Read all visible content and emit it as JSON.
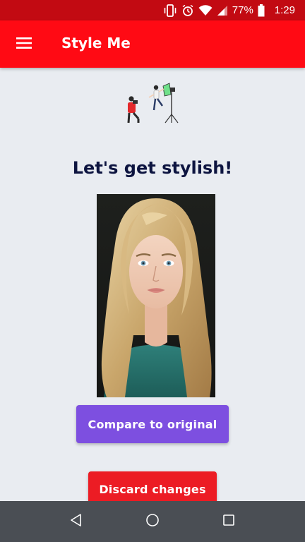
{
  "status_bar": {
    "battery_percent": "77%",
    "time": "1:29",
    "icons": [
      "vibrate-icon",
      "alarm-icon",
      "wifi-icon",
      "signal-icon",
      "battery-icon"
    ]
  },
  "app_bar": {
    "title": "Style Me",
    "menu_icon": "hamburger-menu-icon",
    "color": "#ff0a14"
  },
  "main": {
    "illustration": "photoshoot-illustration",
    "headline": "Let's get stylish!",
    "photo": "portrait-photo",
    "compare_button_label": "Compare to original",
    "discard_button_label": "Discard changes"
  },
  "colors": {
    "headline": "#0d1440",
    "compare_button": "#7d4fe0",
    "discard_button": "#ec1c24",
    "background": "#e9ecf1"
  },
  "nav_bar": {
    "icons": [
      "back-icon",
      "home-icon",
      "recents-icon"
    ]
  }
}
